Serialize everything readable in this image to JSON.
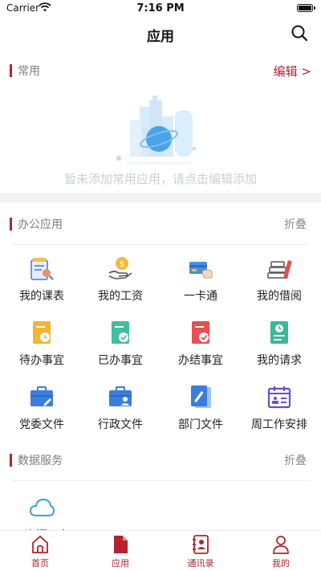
{
  "status_bar": {
    "carrier": "Carrier",
    "time": "7:16 PM"
  },
  "nav": {
    "title": "应用",
    "search_icon": "search-icon"
  },
  "common": {
    "title": "常用",
    "edit_label": "编辑 >",
    "empty_text": "暂未添加常用应用，请点击编辑添加"
  },
  "office": {
    "title": "办公应用",
    "collapse_label": "折叠",
    "apps": [
      {
        "label": "我的课表",
        "icon": "schedule-icon"
      },
      {
        "label": "我的工资",
        "icon": "salary-icon"
      },
      {
        "label": "一卡通",
        "icon": "card-icon"
      },
      {
        "label": "我的借阅",
        "icon": "books-icon"
      },
      {
        "label": "待办事宜",
        "icon": "todo-icon"
      },
      {
        "label": "已办事宜",
        "icon": "done-icon"
      },
      {
        "label": "办结事宜",
        "icon": "completed-icon"
      },
      {
        "label": "我的请求",
        "icon": "request-icon"
      },
      {
        "label": "党委文件",
        "icon": "briefcase-edit-icon"
      },
      {
        "label": "行政文件",
        "icon": "briefcase-person-icon"
      },
      {
        "label": "部门文件",
        "icon": "document-edit-icon"
      },
      {
        "label": "周工作安排",
        "icon": "calendar-icon"
      }
    ]
  },
  "data_service": {
    "title": "数据服务",
    "collapse_label": "折叠",
    "apps": [
      {
        "label": "云资源平台",
        "icon": "cloud-icon"
      }
    ]
  },
  "tabbar": {
    "items": [
      {
        "label": "首页",
        "icon": "home-icon"
      },
      {
        "label": "应用",
        "icon": "app-document-icon"
      },
      {
        "label": "通讯录",
        "icon": "contacts-icon"
      },
      {
        "label": "我的",
        "icon": "user-icon"
      }
    ]
  },
  "colors": {
    "accent": "#b4232d",
    "muted": "#8e8e8e"
  }
}
